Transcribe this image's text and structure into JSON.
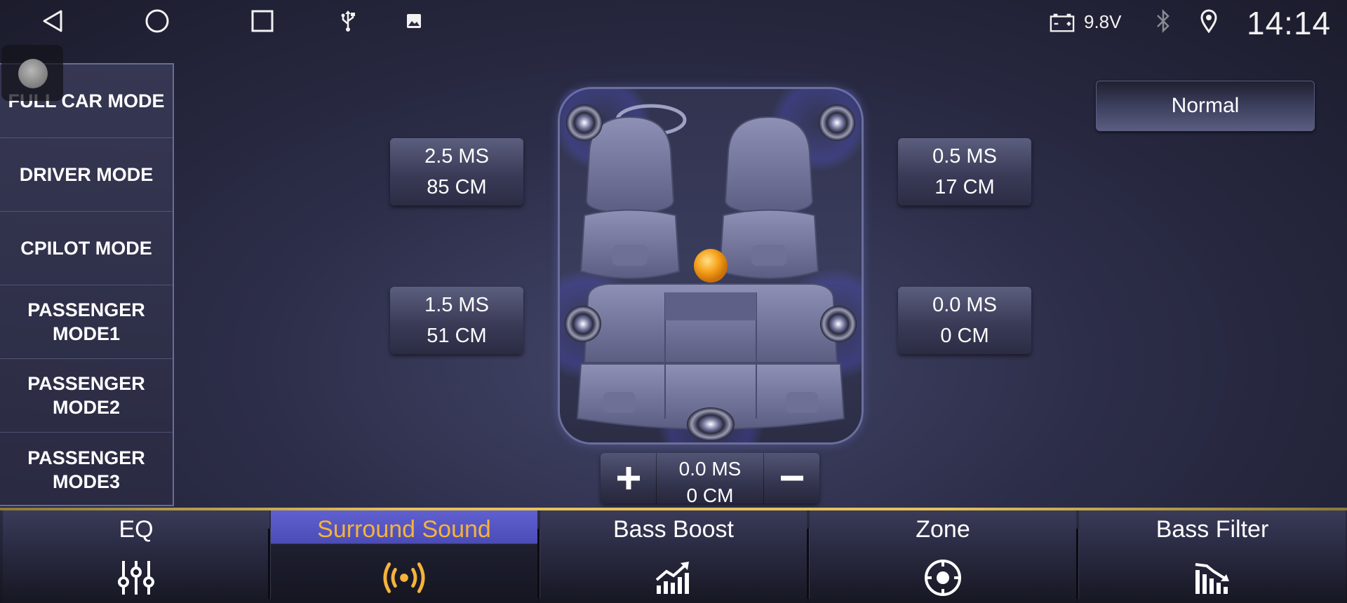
{
  "status_bar": {
    "voltage": "9.8V",
    "time": "14:14",
    "icons": [
      "back-icon",
      "home-icon",
      "recents-icon",
      "usb-icon",
      "gallery-icon",
      "battery-icon",
      "bluetooth-icon",
      "location-icon"
    ]
  },
  "modes": [
    {
      "label": "FULL CAR MODE",
      "selected": true
    },
    {
      "label": "DRIVER MODE"
    },
    {
      "label": "CPILOT MODE"
    },
    {
      "label": "PASSENGER\nMODE1"
    },
    {
      "label": "PASSENGER\nMODE2"
    },
    {
      "label": "PASSENGER\nMODE3"
    }
  ],
  "delays": {
    "front_left": {
      "time": "2.5 MS",
      "distance": "85 CM"
    },
    "front_right": {
      "time": "0.5 MS",
      "distance": "17 CM"
    },
    "rear_left": {
      "time": "1.5 MS",
      "distance": "51 CM"
    },
    "rear_right": {
      "time": "0.0 MS",
      "distance": "0 CM"
    },
    "center": {
      "time": "0.0 MS",
      "distance": "0 CM"
    }
  },
  "preset": "Normal",
  "tabs": [
    {
      "label": "EQ",
      "icon": "eq-sliders-icon"
    },
    {
      "label": "Surround Sound",
      "icon": "surround-sound-icon",
      "active": true
    },
    {
      "label": "Bass Boost",
      "icon": "bass-boost-icon"
    },
    {
      "label": "Zone",
      "icon": "zone-target-icon"
    },
    {
      "label": "Bass Filter",
      "icon": "bass-filter-icon"
    }
  ],
  "colors": {
    "active_tab_text": "#f5b33b",
    "active_tab_bg": "#5f5fd0",
    "accent_line": "#e4c35a",
    "listener_dot": "#f7a21b"
  }
}
